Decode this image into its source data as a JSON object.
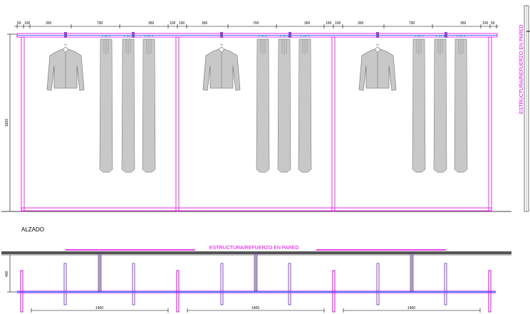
{
  "colors": {
    "magenta": "#e000e0",
    "blue": "#4a6cff",
    "purple": "#8a4ad0",
    "garment_fill": "#c8c8c8",
    "garment_stroke": "#7a7a7a",
    "cyan": "#22c6c6",
    "dark_gray": "#555555"
  },
  "elevation": {
    "top_dims": [
      "50",
      "100",
      "350",
      "700",
      "350",
      "100",
      "100",
      "350",
      "700",
      "350",
      "100",
      "100",
      "350",
      "700",
      "350",
      "100",
      "50"
    ],
    "height_dim": "1820",
    "wall_label": "ESTRUCTURA/REFUERZO EN PARED",
    "caption": "ALZADO"
  },
  "plan": {
    "wall_label": "ESTRUCTURA/REFUERZO EN PARED",
    "depth_dim": "400",
    "module_dims": [
      "1400",
      "1400",
      "1400"
    ]
  }
}
